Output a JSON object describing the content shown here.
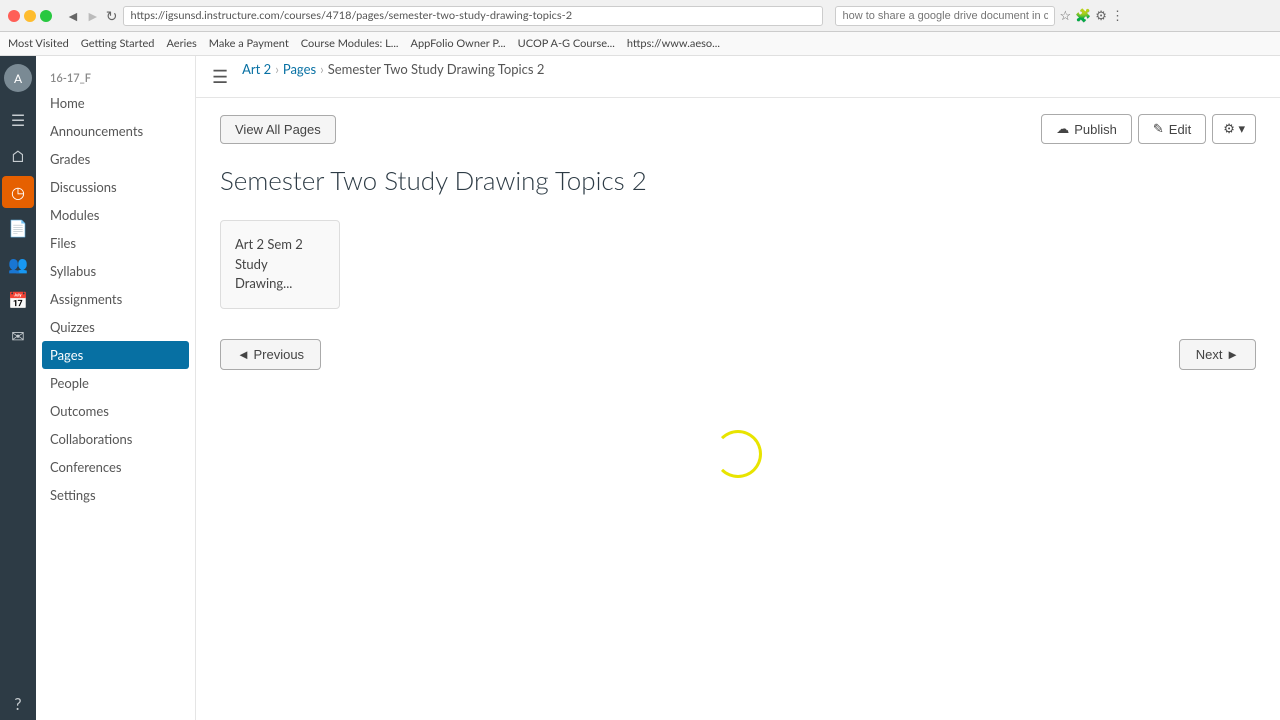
{
  "browser": {
    "url": "https://igsunsd.instructure.com/courses/4718/pages/semester-two-study-drawing-topics-2",
    "search_placeholder": "how to share a google drive document in canvas"
  },
  "bookmarks": [
    {
      "label": "Most Visited"
    },
    {
      "label": "Getting Started"
    },
    {
      "label": "Aeries"
    },
    {
      "label": "Make a Payment"
    },
    {
      "label": "Course Modules: L..."
    },
    {
      "label": "AppFolio Owner P..."
    },
    {
      "label": "UCOP A-G Course..."
    },
    {
      "label": "https://www.aeso..."
    }
  ],
  "breadcrumb": {
    "course": "Art 2",
    "section": "Pages",
    "current": "Semester Two Study Drawing Topics 2",
    "separator": "›"
  },
  "sidebar": {
    "label": "16-17_F",
    "items": [
      {
        "id": "home",
        "label": "Home"
      },
      {
        "id": "announcements",
        "label": "Announcements"
      },
      {
        "id": "grades",
        "label": "Grades"
      },
      {
        "id": "discussions",
        "label": "Discussions"
      },
      {
        "id": "modules",
        "label": "Modules"
      },
      {
        "id": "files",
        "label": "Files"
      },
      {
        "id": "syllabus",
        "label": "Syllabus"
      },
      {
        "id": "assignments",
        "label": "Assignments"
      },
      {
        "id": "quizzes",
        "label": "Quizzes"
      },
      {
        "id": "pages",
        "label": "Pages",
        "active": true
      },
      {
        "id": "people",
        "label": "People"
      },
      {
        "id": "outcomes",
        "label": "Outcomes"
      },
      {
        "id": "collaborations",
        "label": "Collaborations"
      },
      {
        "id": "conferences",
        "label": "Conferences"
      },
      {
        "id": "settings",
        "label": "Settings"
      }
    ]
  },
  "toolbar": {
    "view_all_label": "View All Pages",
    "publish_label": "Publish",
    "edit_label": "Edit",
    "settings_label": "⚙"
  },
  "page": {
    "title": "Semester Two Study Drawing Topics 2",
    "card_line1": "Art 2 Sem 2",
    "card_line2": "Study",
    "card_line3": "Drawing..."
  },
  "navigation": {
    "prev_label": "◄ Previous",
    "next_label": "Next ►"
  },
  "icons": {
    "pencil": "✎",
    "cloud": "☁",
    "hamburger": "☰",
    "chevron_right": "›",
    "arrow_left": "◄",
    "arrow_right": "►"
  }
}
